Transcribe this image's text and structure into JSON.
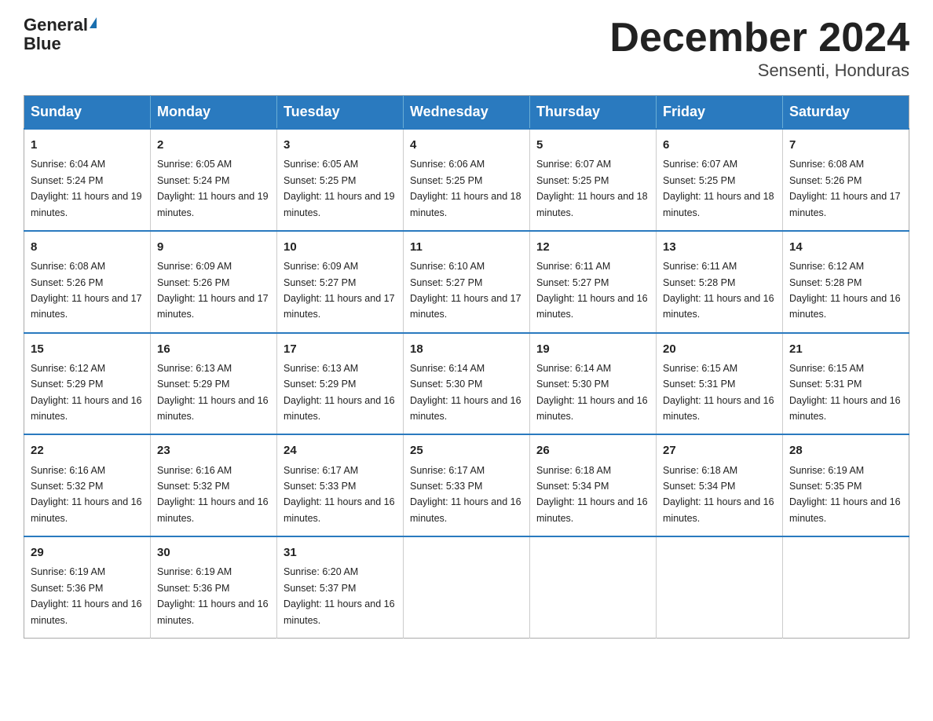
{
  "logo": {
    "line1": "General",
    "line2": "Blue"
  },
  "title": "December 2024",
  "subtitle": "Sensenti, Honduras",
  "days_of_week": [
    "Sunday",
    "Monday",
    "Tuesday",
    "Wednesday",
    "Thursday",
    "Friday",
    "Saturday"
  ],
  "weeks": [
    [
      {
        "day": 1,
        "sunrise": "6:04 AM",
        "sunset": "5:24 PM",
        "daylight": "11 hours and 19 minutes."
      },
      {
        "day": 2,
        "sunrise": "6:05 AM",
        "sunset": "5:24 PM",
        "daylight": "11 hours and 19 minutes."
      },
      {
        "day": 3,
        "sunrise": "6:05 AM",
        "sunset": "5:25 PM",
        "daylight": "11 hours and 19 minutes."
      },
      {
        "day": 4,
        "sunrise": "6:06 AM",
        "sunset": "5:25 PM",
        "daylight": "11 hours and 18 minutes."
      },
      {
        "day": 5,
        "sunrise": "6:07 AM",
        "sunset": "5:25 PM",
        "daylight": "11 hours and 18 minutes."
      },
      {
        "day": 6,
        "sunrise": "6:07 AM",
        "sunset": "5:25 PM",
        "daylight": "11 hours and 18 minutes."
      },
      {
        "day": 7,
        "sunrise": "6:08 AM",
        "sunset": "5:26 PM",
        "daylight": "11 hours and 17 minutes."
      }
    ],
    [
      {
        "day": 8,
        "sunrise": "6:08 AM",
        "sunset": "5:26 PM",
        "daylight": "11 hours and 17 minutes."
      },
      {
        "day": 9,
        "sunrise": "6:09 AM",
        "sunset": "5:26 PM",
        "daylight": "11 hours and 17 minutes."
      },
      {
        "day": 10,
        "sunrise": "6:09 AM",
        "sunset": "5:27 PM",
        "daylight": "11 hours and 17 minutes."
      },
      {
        "day": 11,
        "sunrise": "6:10 AM",
        "sunset": "5:27 PM",
        "daylight": "11 hours and 17 minutes."
      },
      {
        "day": 12,
        "sunrise": "6:11 AM",
        "sunset": "5:27 PM",
        "daylight": "11 hours and 16 minutes."
      },
      {
        "day": 13,
        "sunrise": "6:11 AM",
        "sunset": "5:28 PM",
        "daylight": "11 hours and 16 minutes."
      },
      {
        "day": 14,
        "sunrise": "6:12 AM",
        "sunset": "5:28 PM",
        "daylight": "11 hours and 16 minutes."
      }
    ],
    [
      {
        "day": 15,
        "sunrise": "6:12 AM",
        "sunset": "5:29 PM",
        "daylight": "11 hours and 16 minutes."
      },
      {
        "day": 16,
        "sunrise": "6:13 AM",
        "sunset": "5:29 PM",
        "daylight": "11 hours and 16 minutes."
      },
      {
        "day": 17,
        "sunrise": "6:13 AM",
        "sunset": "5:29 PM",
        "daylight": "11 hours and 16 minutes."
      },
      {
        "day": 18,
        "sunrise": "6:14 AM",
        "sunset": "5:30 PM",
        "daylight": "11 hours and 16 minutes."
      },
      {
        "day": 19,
        "sunrise": "6:14 AM",
        "sunset": "5:30 PM",
        "daylight": "11 hours and 16 minutes."
      },
      {
        "day": 20,
        "sunrise": "6:15 AM",
        "sunset": "5:31 PM",
        "daylight": "11 hours and 16 minutes."
      },
      {
        "day": 21,
        "sunrise": "6:15 AM",
        "sunset": "5:31 PM",
        "daylight": "11 hours and 16 minutes."
      }
    ],
    [
      {
        "day": 22,
        "sunrise": "6:16 AM",
        "sunset": "5:32 PM",
        "daylight": "11 hours and 16 minutes."
      },
      {
        "day": 23,
        "sunrise": "6:16 AM",
        "sunset": "5:32 PM",
        "daylight": "11 hours and 16 minutes."
      },
      {
        "day": 24,
        "sunrise": "6:17 AM",
        "sunset": "5:33 PM",
        "daylight": "11 hours and 16 minutes."
      },
      {
        "day": 25,
        "sunrise": "6:17 AM",
        "sunset": "5:33 PM",
        "daylight": "11 hours and 16 minutes."
      },
      {
        "day": 26,
        "sunrise": "6:18 AM",
        "sunset": "5:34 PM",
        "daylight": "11 hours and 16 minutes."
      },
      {
        "day": 27,
        "sunrise": "6:18 AM",
        "sunset": "5:34 PM",
        "daylight": "11 hours and 16 minutes."
      },
      {
        "day": 28,
        "sunrise": "6:19 AM",
        "sunset": "5:35 PM",
        "daylight": "11 hours and 16 minutes."
      }
    ],
    [
      {
        "day": 29,
        "sunrise": "6:19 AM",
        "sunset": "5:36 PM",
        "daylight": "11 hours and 16 minutes."
      },
      {
        "day": 30,
        "sunrise": "6:19 AM",
        "sunset": "5:36 PM",
        "daylight": "11 hours and 16 minutes."
      },
      {
        "day": 31,
        "sunrise": "6:20 AM",
        "sunset": "5:37 PM",
        "daylight": "11 hours and 16 minutes."
      },
      null,
      null,
      null,
      null
    ]
  ]
}
